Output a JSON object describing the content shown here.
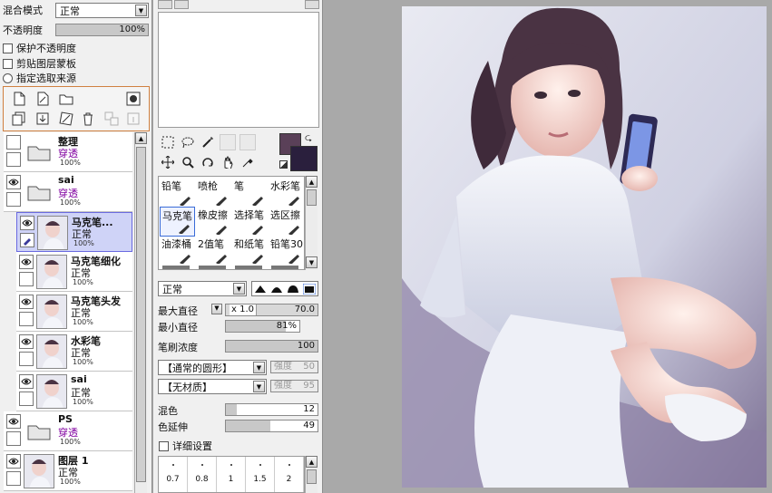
{
  "left_panel": {
    "blend_label": "混合模式",
    "blend_value": "正常",
    "opacity_label": "不透明度",
    "opacity_value": "100%",
    "opacity_fraction": 1.0,
    "preserve_opacity": "保护不透明度",
    "clip_mask": "剪贴图层蒙板",
    "selection_source": "指定选取来源",
    "layers": [
      {
        "name": "整理",
        "mode": "穿透",
        "opacity": "100%",
        "type": "folder",
        "visible": false,
        "sub": false,
        "selected": false
      },
      {
        "name": "sai",
        "mode": "穿透",
        "opacity": "100%",
        "type": "folder",
        "visible": true,
        "sub": false,
        "selected": false
      },
      {
        "name": "马克笔...",
        "mode": "正常",
        "opacity": "100%",
        "type": "layer",
        "visible": true,
        "sub": true,
        "selected": true
      },
      {
        "name": "马克笔细化",
        "mode": "正常",
        "opacity": "100%",
        "type": "layer",
        "visible": true,
        "sub": true,
        "selected": false
      },
      {
        "name": "马克笔头发",
        "mode": "正常",
        "opacity": "100%",
        "type": "layer",
        "visible": true,
        "sub": true,
        "selected": false
      },
      {
        "name": "水彩笔",
        "mode": "正常",
        "opacity": "100%",
        "type": "layer",
        "visible": true,
        "sub": true,
        "selected": false
      },
      {
        "name": "sai",
        "mode": "正常",
        "opacity": "100%",
        "type": "layer",
        "visible": true,
        "sub": true,
        "selected": false
      },
      {
        "name": "PS",
        "mode": "穿透",
        "opacity": "100%",
        "type": "folder",
        "visible": true,
        "sub": false,
        "selected": false
      },
      {
        "name": "图层 1",
        "mode": "正常",
        "opacity": "100%",
        "type": "layer",
        "visible": true,
        "sub": false,
        "selected": false
      }
    ]
  },
  "colors": {
    "primary": "#5a4058",
    "secondary": "#2a1f3d",
    "selected_layer": "#cfd3f7",
    "purple_text": "#8000a0"
  },
  "brushes": {
    "items": [
      {
        "label": "铅笔",
        "selected": false
      },
      {
        "label": "喷枪",
        "selected": false
      },
      {
        "label": "笔",
        "selected": false
      },
      {
        "label": "水彩笔",
        "selected": false
      },
      {
        "label": "马克笔",
        "selected": true
      },
      {
        "label": "橡皮擦",
        "selected": false
      },
      {
        "label": "选择笔",
        "selected": false
      },
      {
        "label": "选区擦",
        "selected": false
      },
      {
        "label": "油漆桶",
        "selected": false
      },
      {
        "label": "2值笔",
        "selected": false
      },
      {
        "label": "和纸笔",
        "selected": false
      },
      {
        "label": "铅笔30",
        "selected": false
      }
    ]
  },
  "brush_settings": {
    "mode_value": "正常",
    "max_diam_label": "最大直径",
    "max_diam_mult": "x 1.0",
    "max_diam_value": "70.0",
    "min_diam_label": "最小直径",
    "min_diam_value": "81%",
    "min_diam_fraction": 0.81,
    "density_label": "笔刷浓度",
    "density_value": "100",
    "density_fraction": 1.0,
    "shape_value": "【通常的圆形】",
    "shape_strength_label": "强度",
    "shape_strength_value": "50",
    "texture_value": "【无材质】",
    "texture_strength_label": "强度",
    "texture_strength_value": "95",
    "blend_label": "混色",
    "blend_value": "12",
    "blend_fraction": 0.12,
    "dilution_label": "色延伸",
    "dilution_value": "49",
    "dilution_fraction": 0.49,
    "detail_label": "详细设置",
    "size_presets": [
      "0.7",
      "0.8",
      "1",
      "1.5",
      "2"
    ]
  }
}
